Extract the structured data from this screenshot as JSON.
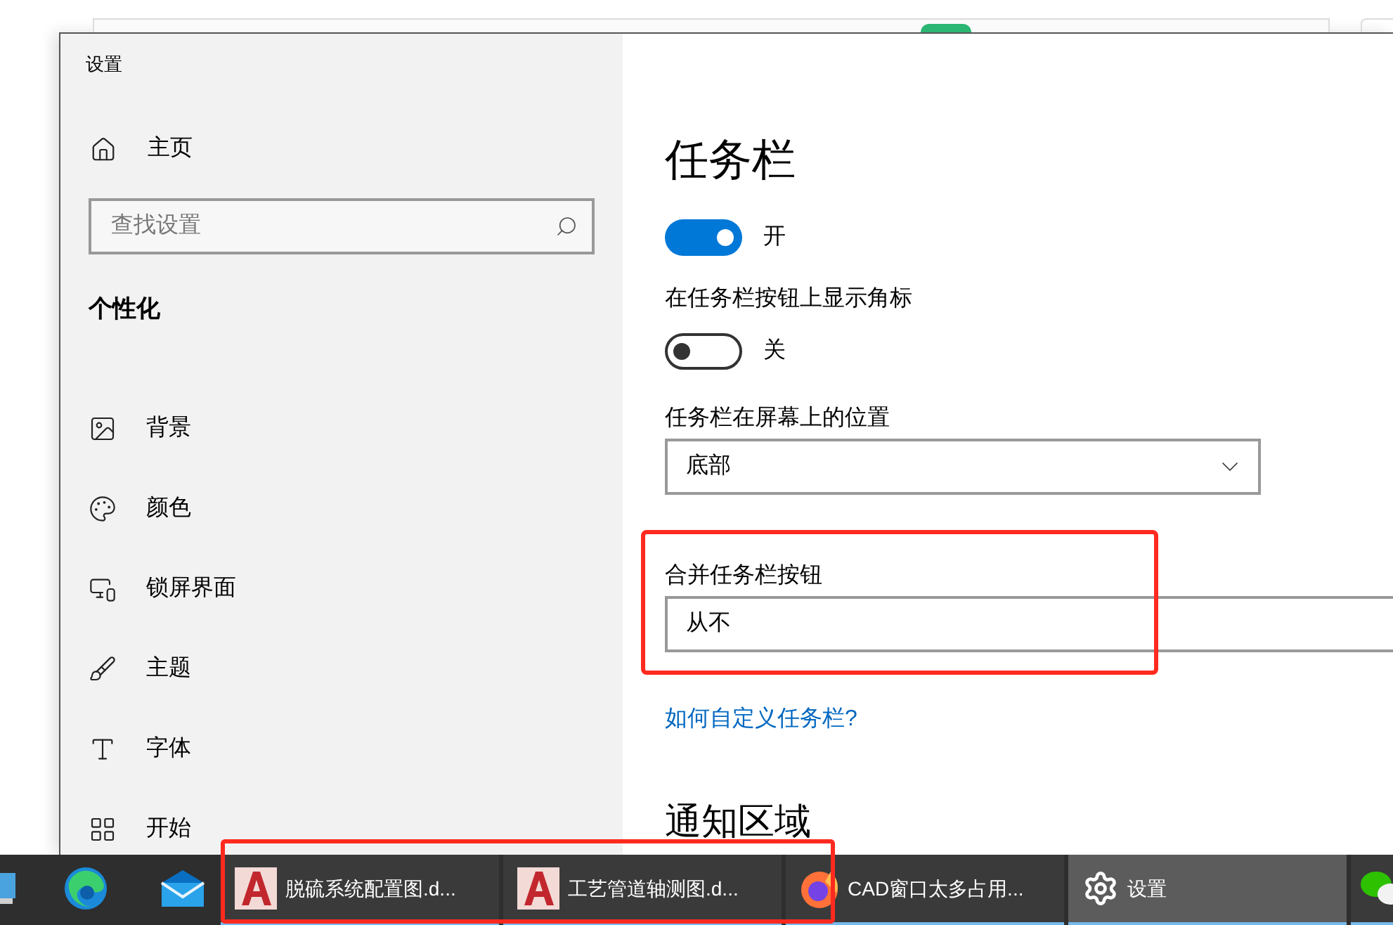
{
  "window": {
    "title": "设置"
  },
  "sidebar": {
    "home": "主页",
    "search": {
      "placeholder": "查找设置"
    },
    "section": "个性化",
    "items": [
      {
        "label": "背景"
      },
      {
        "label": "颜色"
      },
      {
        "label": "锁屏界面"
      },
      {
        "label": "主题"
      },
      {
        "label": "字体"
      },
      {
        "label": "开始"
      }
    ]
  },
  "content": {
    "title": "任务栏",
    "settings": [
      {
        "kind": "toggle",
        "on": true,
        "state_label": "开"
      },
      {
        "kind": "toggle",
        "label": "在任务栏按钮上显示角标",
        "on": false,
        "state_label": "关"
      },
      {
        "kind": "dropdown",
        "label": "任务栏在屏幕上的位置",
        "value": "底部"
      },
      {
        "kind": "dropdown",
        "label": "合并任务栏按钮",
        "value": "从不",
        "highlighted": true
      }
    ],
    "link": "如何自定义任务栏?",
    "next_section": "通知区域"
  },
  "taskbar": {
    "items": [
      {
        "kind": "partial",
        "running": false,
        "selected": false
      },
      {
        "kind": "edge",
        "running": false,
        "selected": false
      },
      {
        "kind": "mail",
        "running": false,
        "selected": false
      },
      {
        "kind": "cad",
        "label": "脱硫系统配置图.d...",
        "running": true,
        "selected": false,
        "highlighted": true
      },
      {
        "kind": "cad",
        "label": "工艺管道轴测图.d...",
        "running": true,
        "selected": false,
        "highlighted": true
      },
      {
        "kind": "firefox",
        "label": "CAD窗口太多占用...",
        "running": true,
        "selected": false
      },
      {
        "kind": "gear",
        "label": "设置",
        "running": true,
        "selected": true
      },
      {
        "kind": "chat",
        "running": true,
        "selected": false
      }
    ]
  }
}
